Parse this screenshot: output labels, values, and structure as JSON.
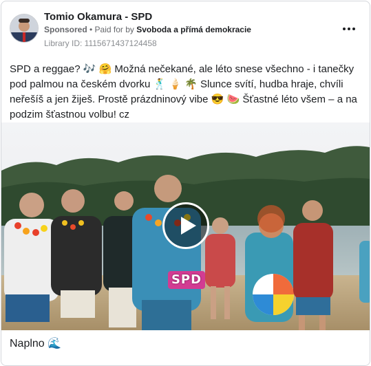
{
  "ad": {
    "page_name": "Tomio Okamura - SPD",
    "sponsored": "Sponsored",
    "separator": " • ",
    "paid_for_prefix": "Paid for by ",
    "payer": "Svoboda a přímá demokracie",
    "library_id": "Library ID: 1115671437124458",
    "more_icon": "more-horizontal-icon",
    "body_text": "SPD a reggae? 🎶 🤗 Možná nečekané, ale léto snese všechno - i tanečky pod palmou na českém dvorku 🕺 🍦 🌴 Slunce svítí, hudba hraje, chvíli neřešíš a jen žiješ. Prostě prázdninový vibe 😎 🍉 Šťastné léto všem – a na podzim šťastnou volbu! cz",
    "video": {
      "play_icon": "play-icon",
      "overlay_logo": "SPD"
    },
    "cta_label": "Naplno 🌊"
  },
  "colors": {
    "text": "#1c1e21",
    "secondary_text": "#65676b",
    "border": "#d3d6db",
    "logo_pink": "#d23c92"
  }
}
